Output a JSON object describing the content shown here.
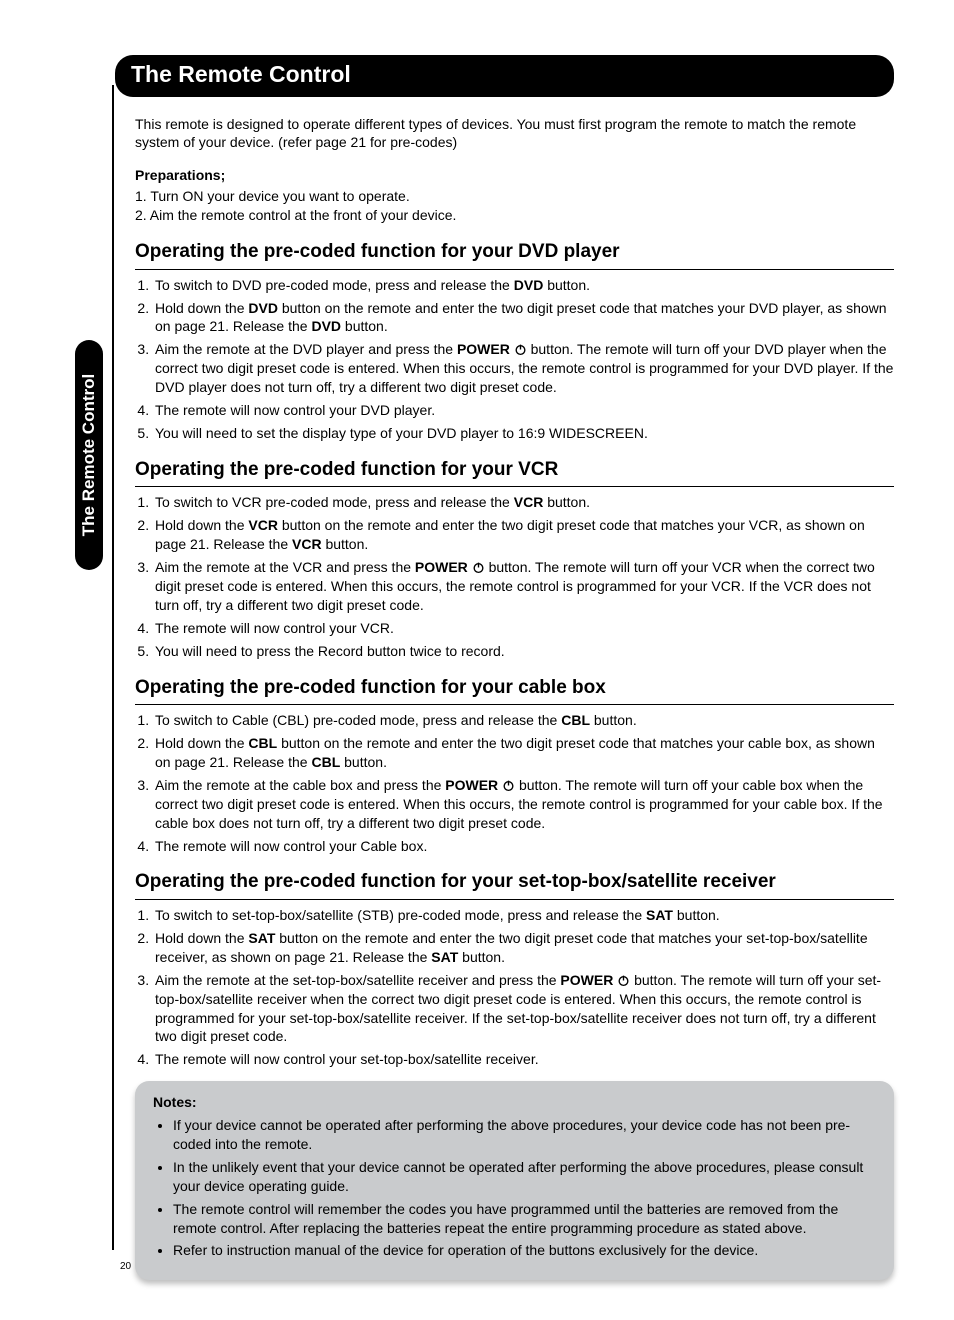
{
  "page_number": "20",
  "title_bar": "The Remote Control",
  "side_tab": "The Remote Control",
  "intro": "This remote is designed to operate different types of devices. You must first program the remote to match the remote system of your device. (refer page 21 for pre-codes)",
  "prep": {
    "heading": "Preparations;",
    "items": [
      "1. Turn ON your device you want to operate.",
      "2. Aim the remote control at the front of your device."
    ]
  },
  "sections": {
    "dvd": {
      "heading": "Operating the pre-coded function for your DVD player",
      "s1a": "To switch to DVD pre-coded mode, press and release the ",
      "s1b": "DVD",
      "s1c": " button.",
      "s2a": "Hold down the ",
      "s2b": "DVD",
      "s2c": " button on the remote and enter the two digit preset code that matches your DVD player, as shown on page 21. Release the ",
      "s2d": "DVD",
      "s2e": " button.",
      "s3a": "Aim the remote at the DVD player and press the ",
      "s3b": "POWER",
      "s3c": " button. The remote will turn off your DVD player when the correct two digit preset code is entered. When this occurs, the remote control is programmed for your DVD player. If the DVD player does not turn off, try a different two digit preset code.",
      "s4": "The remote will now control your DVD player.",
      "s5": "You will need to set the display type of your DVD player to 16:9 WIDESCREEN."
    },
    "vcr": {
      "heading": "Operating the pre-coded function for your VCR",
      "s1a": "To switch to VCR pre-coded mode, press and release the ",
      "s1b": "VCR",
      "s1c": " button.",
      "s2a": "Hold down the ",
      "s2b": "VCR",
      "s2c": " button on the remote and enter the two digit preset code that matches your VCR, as shown on page 21. Release the ",
      "s2d": "VCR",
      "s2e": " button.",
      "s3a": "Aim the remote at the VCR and press the ",
      "s3b": "POWER",
      "s3c": " button. The remote will turn off your VCR when the correct two digit preset code is entered. When this occurs, the remote control is programmed for your VCR. If the VCR does not turn off, try a different two digit preset code.",
      "s4": "The remote will now control your VCR.",
      "s5": " You will need to press the Record button twice to record."
    },
    "cbl": {
      "heading": "Operating the pre-coded function for your cable box",
      "s1a": "To switch to Cable (CBL) pre-coded mode, press and release the ",
      "s1b": "CBL",
      "s1c": " button.",
      "s2a": "Hold down the ",
      "s2b": "CBL",
      "s2c": " button on the remote and enter the two digit preset code that matches your cable box, as shown on page 21. Release the ",
      "s2d": "CBL",
      "s2e": " button.",
      "s3a": "Aim the remote at the cable box and press the ",
      "s3b": "POWER",
      "s3c": " button. The remote will turn off your cable box when the correct two digit preset code is entered. When this occurs, the remote control is programmed for your cable box. If the cable box does not turn off, try a different two digit preset code.",
      "s4": "The remote will now control your Cable box."
    },
    "sat": {
      "heading": "Operating the pre-coded function for your set-top-box/satellite receiver",
      "s1a": "To switch to set-top-box/satellite (STB) pre-coded mode, press and release the ",
      "s1b": "SAT",
      "s1c": " button.",
      "s2a": "Hold down the ",
      "s2b": "SAT",
      "s2c": " button on the remote and enter the two digit preset code that matches your set-top-box/satellite receiver, as shown on page 21. Release the ",
      "s2d": "SAT",
      "s2e": " button.",
      "s3a": "Aim the remote at the set-top-box/satellite receiver and press the ",
      "s3b": "POWER",
      "s3c": " button. The remote will turn off your set-top-box/satellite receiver when the correct two digit preset code is entered. When this occurs, the remote control is programmed for your set-top-box/satellite receiver. If the set-top-box/satellite receiver does not turn off, try a different two digit preset code.",
      "s4": "The remote will now control your set-top-box/satellite receiver."
    }
  },
  "notes": {
    "heading": "Notes:",
    "items": [
      "If your device cannot be operated after performing the above procedures, your device code has not been pre-coded into the remote.",
      "In the unlikely event that your device cannot be operated after performing the above procedures, please consult your device operating guide.",
      "The remote control will remember the codes you have programmed until the batteries are removed from the remote control. After replacing the batteries repeat the entire programming procedure as stated above.",
      "Refer to instruction manual of the device for operation of the buttons exclusively for the device."
    ]
  }
}
